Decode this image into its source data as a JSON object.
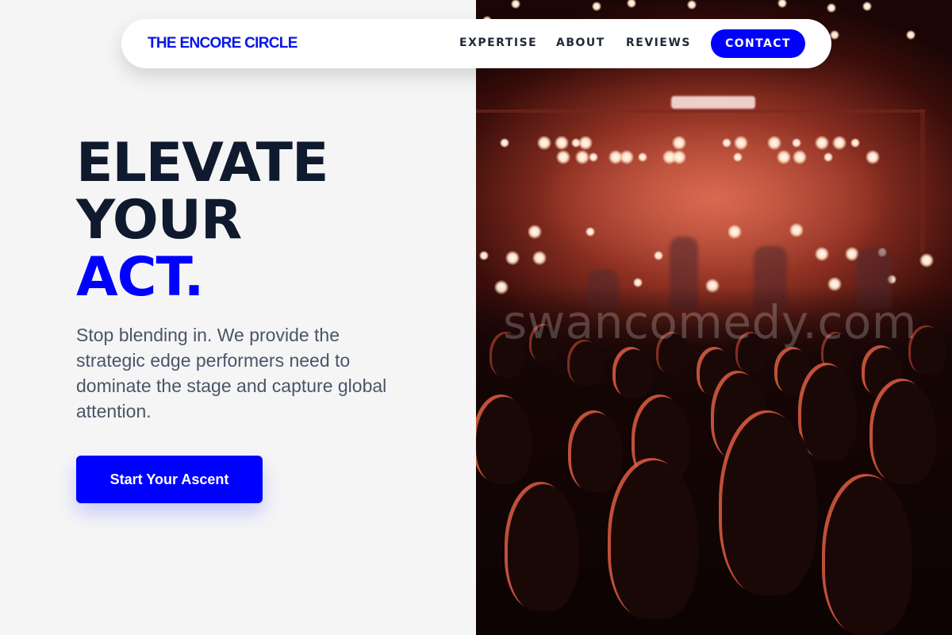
{
  "nav": {
    "brand": "THE ENCORE CIRCLE",
    "links": [
      {
        "label": "EXPERTISE"
      },
      {
        "label": "ABOUT"
      },
      {
        "label": "REVIEWS"
      }
    ],
    "cta_label": "CONTACT"
  },
  "hero": {
    "headline": {
      "line1": "ELEVATE",
      "line2": "YOUR",
      "line3": "ACT."
    },
    "subtext": "Stop blending in. We provide the strategic edge performers need to dominate the stage and capture global attention.",
    "cta_label": "Start Your Ascent"
  },
  "image": {
    "description_icon": "concert-crowd-photo",
    "watermark": "swancomedy.com"
  },
  "colors": {
    "accent": "#0000ff",
    "headline": "#101a2e",
    "body_text": "#4a5568",
    "page_bg": "#f5f5f6"
  }
}
